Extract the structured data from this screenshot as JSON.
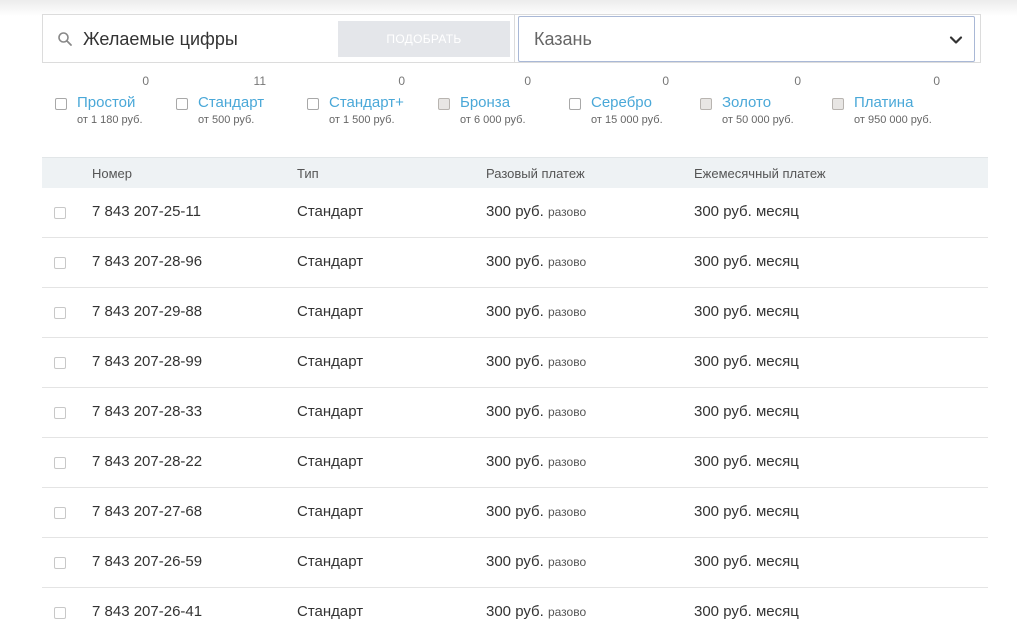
{
  "search": {
    "placeholder": "Желаемые цифры",
    "button_label": "ПОДОБРАТЬ",
    "city": "Казань"
  },
  "tariffs": [
    {
      "name": "Простой",
      "price": "от 1 180 руб.",
      "count": "0",
      "disabled": false
    },
    {
      "name": "Стандарт",
      "price": "от 500 руб.",
      "count": "11",
      "disabled": false
    },
    {
      "name": "Стандарт+",
      "price": "от 1 500 руб.",
      "count": "0",
      "disabled": false
    },
    {
      "name": "Бронза",
      "price": "от 6 000 руб.",
      "count": "0",
      "disabled": true
    },
    {
      "name": "Серебро",
      "price": "от 15 000 руб.",
      "count": "0",
      "disabled": false
    },
    {
      "name": "Золото",
      "price": "от 50 000 руб.",
      "count": "0",
      "disabled": true
    },
    {
      "name": "Платина",
      "price": "от 950 000 руб.",
      "count": "0",
      "disabled": true
    }
  ],
  "table": {
    "headers": {
      "number": "Номер",
      "type": "Тип",
      "one_time": "Разовый платеж",
      "monthly": "Ежемесячный платеж"
    },
    "rows": [
      {
        "number": "7 843 207-25-11",
        "type": "Стандарт",
        "one_time": "300 руб.",
        "one_time_unit": "разово",
        "monthly": "300 руб.",
        "monthly_unit": "месяц"
      },
      {
        "number": "7 843 207-28-96",
        "type": "Стандарт",
        "one_time": "300 руб.",
        "one_time_unit": "разово",
        "monthly": "300 руб.",
        "monthly_unit": "месяц"
      },
      {
        "number": "7 843 207-29-88",
        "type": "Стандарт",
        "one_time": "300 руб.",
        "one_time_unit": "разово",
        "monthly": "300 руб.",
        "monthly_unit": "месяц"
      },
      {
        "number": "7 843 207-28-99",
        "type": "Стандарт",
        "one_time": "300 руб.",
        "one_time_unit": "разово",
        "monthly": "300 руб.",
        "monthly_unit": "месяц"
      },
      {
        "number": "7 843 207-28-33",
        "type": "Стандарт",
        "one_time": "300 руб.",
        "one_time_unit": "разово",
        "monthly": "300 руб.",
        "monthly_unit": "месяц"
      },
      {
        "number": "7 843 207-28-22",
        "type": "Стандарт",
        "one_time": "300 руб.",
        "one_time_unit": "разово",
        "monthly": "300 руб.",
        "monthly_unit": "месяц"
      },
      {
        "number": "7 843 207-27-68",
        "type": "Стандарт",
        "one_time": "300 руб.",
        "one_time_unit": "разово",
        "monthly": "300 руб.",
        "monthly_unit": "месяц"
      },
      {
        "number": "7 843 207-26-59",
        "type": "Стандарт",
        "one_time": "300 руб.",
        "one_time_unit": "разово",
        "monthly": "300 руб.",
        "monthly_unit": "месяц"
      },
      {
        "number": "7 843 207-26-41",
        "type": "Стандарт",
        "one_time": "300 руб.",
        "one_time_unit": "разово",
        "monthly": "300 руб.",
        "monthly_unit": "месяц"
      }
    ]
  },
  "colors": {
    "accent_link": "#4aa8d8",
    "header_bg": "#eef2f4",
    "button_bg": "#e4e6ea",
    "select_border": "#a9b8d6"
  },
  "icons": {
    "search": "search-icon",
    "dropdown": "chevron-down-icon"
  }
}
